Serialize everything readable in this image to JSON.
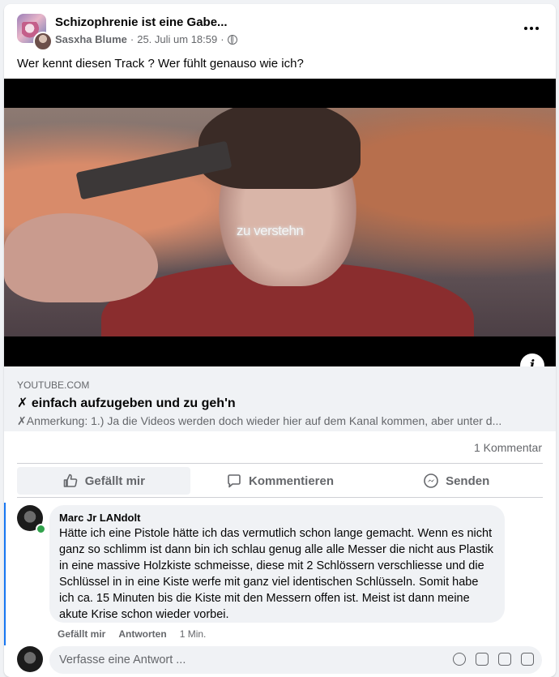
{
  "post": {
    "group_name": "Schizophrenie ist eine Gabe...",
    "author": "Sasxha Blume",
    "separator": "·",
    "date": "25. Juli um 18:59",
    "text": "Wer kennt diesen Track ?  Wer fühlt genauso wie ich?"
  },
  "video": {
    "overlay_caption": "zu verstehn",
    "info_label": "i"
  },
  "link_preview": {
    "domain": "YOUTUBE.COM",
    "title": "✗ einfach aufzugeben und zu geh'n",
    "description": "✗Anmerkung: 1.) Ja die Videos werden doch wieder hier auf dem Kanal kommen, aber unter d..."
  },
  "stats": {
    "comment_count": "1 Kommentar"
  },
  "actions": {
    "like": "Gefällt mir",
    "comment": "Kommentieren",
    "send": "Senden"
  },
  "comment": {
    "author": "Marc Jr LANdolt",
    "text": "Hätte ich eine Pistole hätte ich das vermutlich schon lange gemacht. Wenn es nicht ganz so schlimm ist dann bin ich schlau genug alle alle Messer die nicht aus Plastik in eine massive Holzkiste schmeisse, diese mit 2 Schlössern verschliesse und die Schlüssel in in eine Kiste werfe mit ganz viel identischen Schlüsseln. Somit habe ich ca. 15 Minuten bis die Kiste mit den Messern offen ist. Meist ist dann meine akute Krise schon wieder vorbei.",
    "like_label": "Gefällt mir",
    "reply_label": "Antworten",
    "time": "1 Min."
  },
  "reply_box": {
    "placeholder": "Verfasse eine Antwort ..."
  },
  "colors": {
    "accent": "#1877f2",
    "online": "#31a24c",
    "secondary_text": "#65676b"
  }
}
